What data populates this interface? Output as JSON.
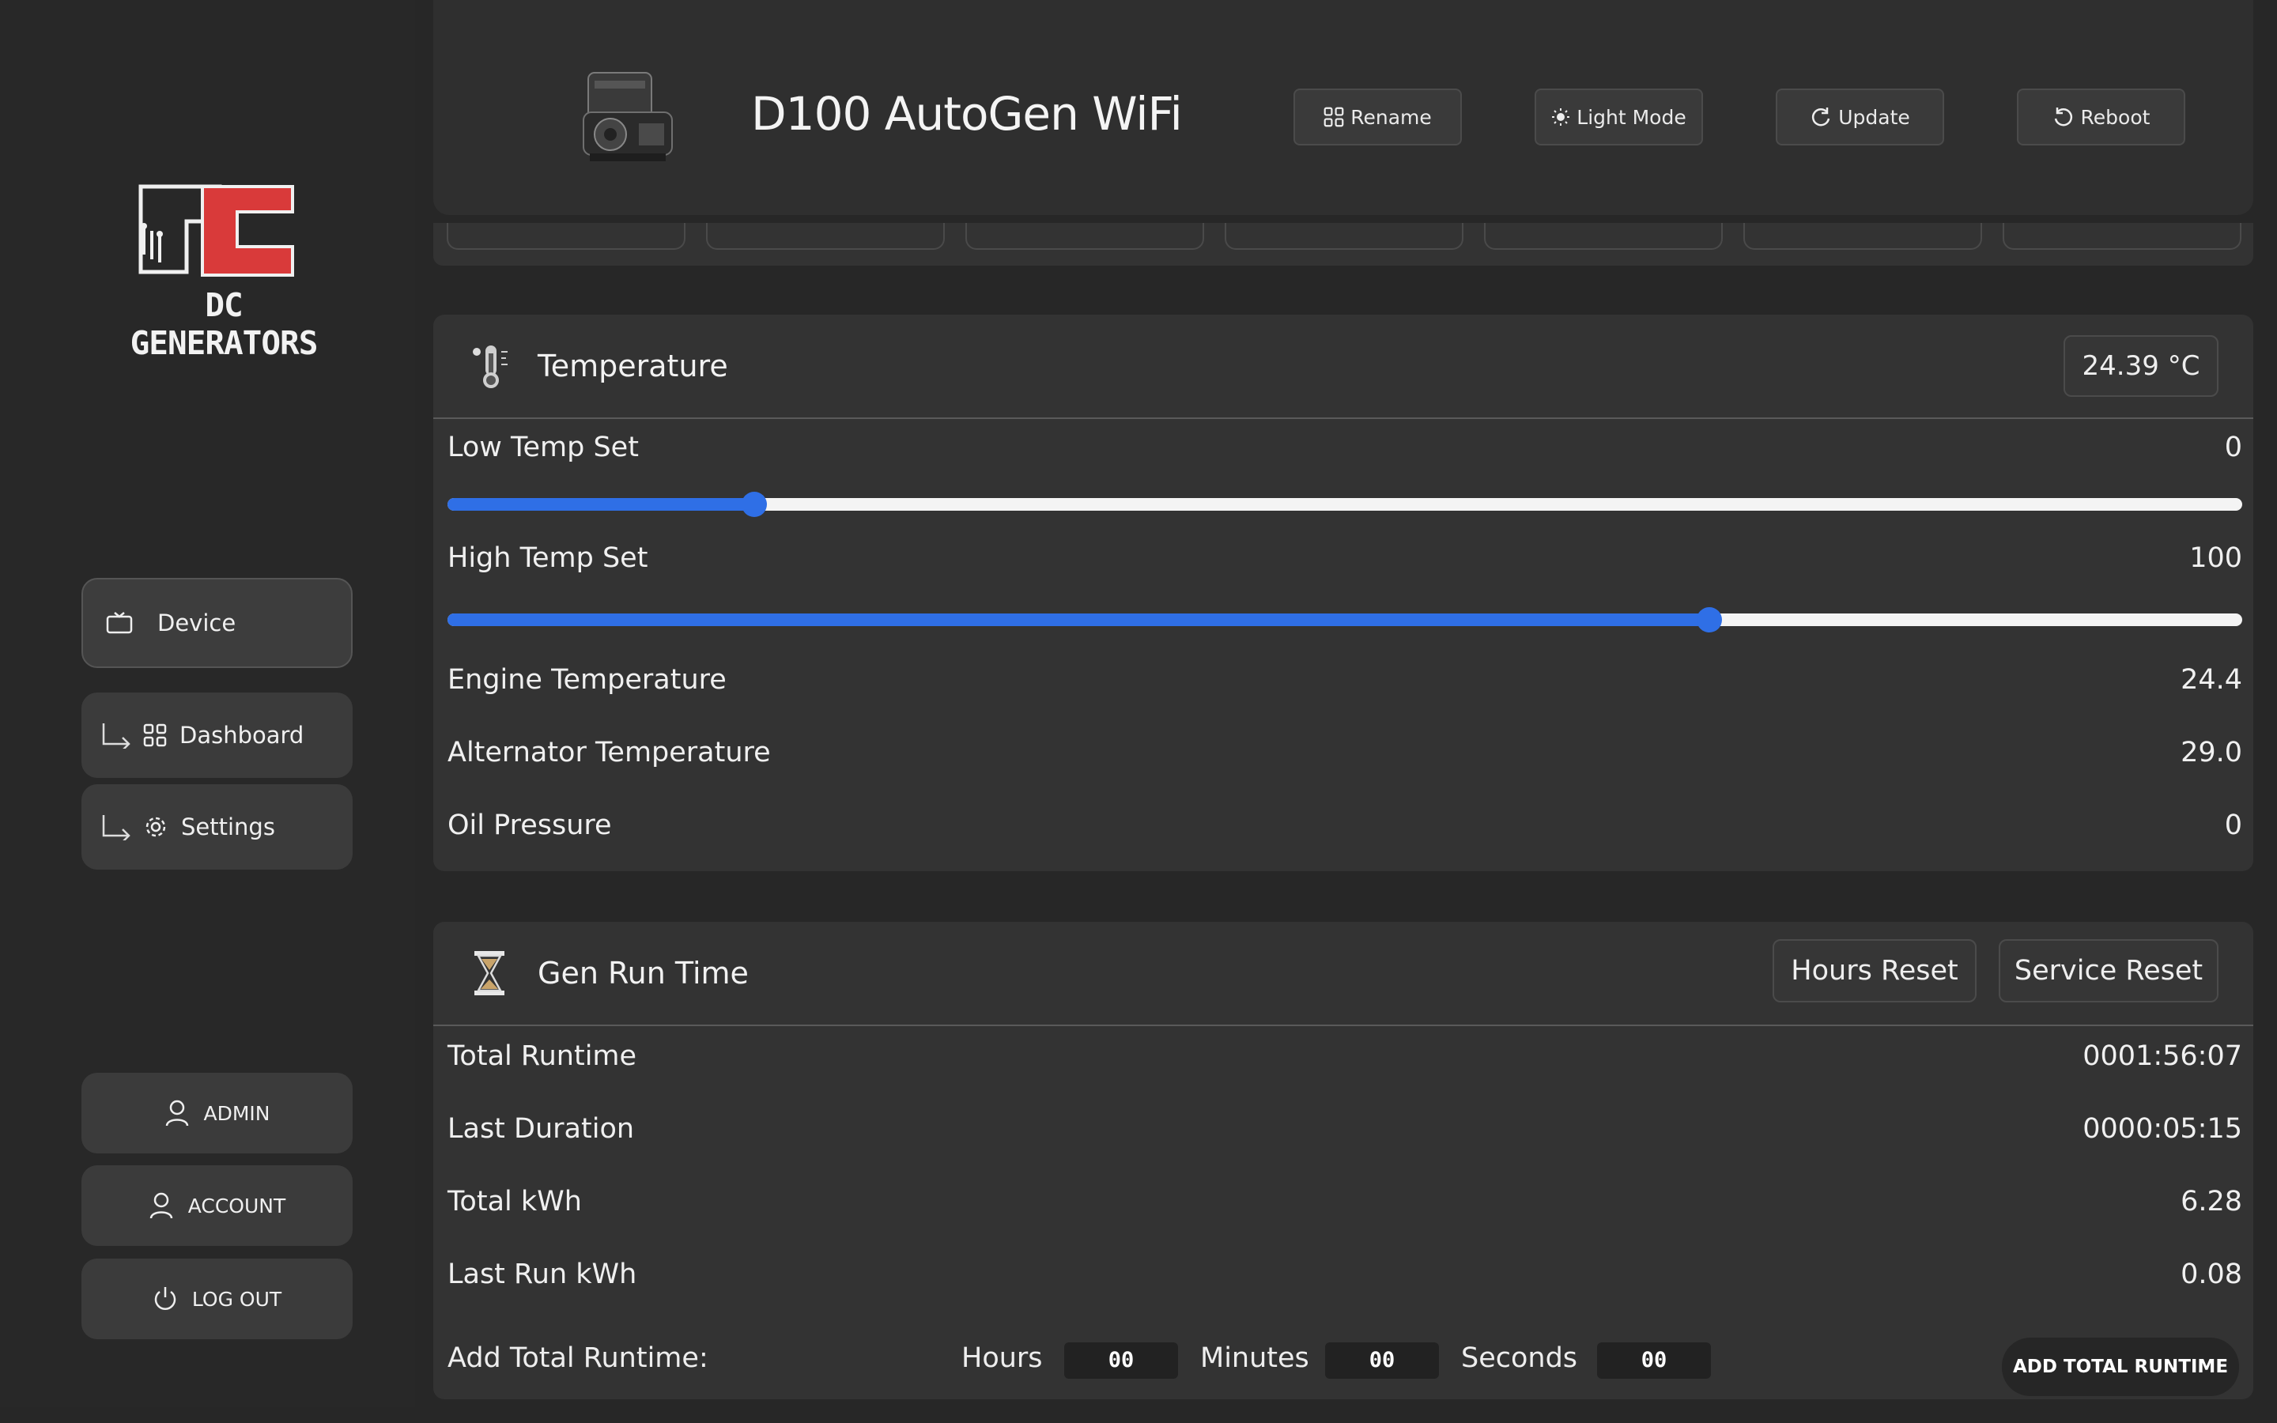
{
  "brand": {
    "name": "DC GENERATORS",
    "accent": "#d93a3a"
  },
  "header": {
    "title": "D100 AutoGen WiFi",
    "buttons": {
      "rename": "Rename",
      "light_mode": "Light Mode",
      "update": "Update",
      "reboot": "Reboot"
    }
  },
  "sidebar": {
    "items": [
      {
        "label": "Device",
        "icon": "tv-icon"
      },
      {
        "label": "Dashboard",
        "icon": "grid-icon"
      },
      {
        "label": "Settings",
        "icon": "gear-icon"
      }
    ],
    "account": {
      "admin": "ADMIN",
      "account": "ACCOUNT",
      "logout": "LOG OUT"
    }
  },
  "temperature": {
    "title": "Temperature",
    "reading": "24.39 °C",
    "low_set": {
      "label": "Low Temp Set",
      "value": "0",
      "fill_fraction": 0.171
    },
    "high_set": {
      "label": "High Temp Set",
      "value": "100",
      "fill_fraction": 0.703
    },
    "rows": [
      {
        "label": "Engine Temperature",
        "value": "24.4"
      },
      {
        "label": "Alternator Temperature",
        "value": "29.0"
      },
      {
        "label": "Oil Pressure",
        "value": "0"
      }
    ],
    "slider_color": "#2f6fe6"
  },
  "runtime": {
    "title": "Gen Run Time",
    "hours_reset": "Hours Reset",
    "service_reset": "Service Reset",
    "rows": [
      {
        "label": "Total Runtime",
        "value": "0001:56:07"
      },
      {
        "label": "Last Duration",
        "value": "0000:05:15"
      },
      {
        "label": "Total kWh",
        "value": "6.28"
      },
      {
        "label": "Last Run kWh",
        "value": "0.08"
      }
    ],
    "add": {
      "label": "Add Total Runtime:",
      "hours_label": "Hours",
      "hours_value": "00",
      "minutes_label": "Minutes",
      "minutes_value": "00",
      "seconds_label": "Seconds",
      "seconds_value": "00",
      "button": "ADD TOTAL RUNTIME"
    }
  }
}
